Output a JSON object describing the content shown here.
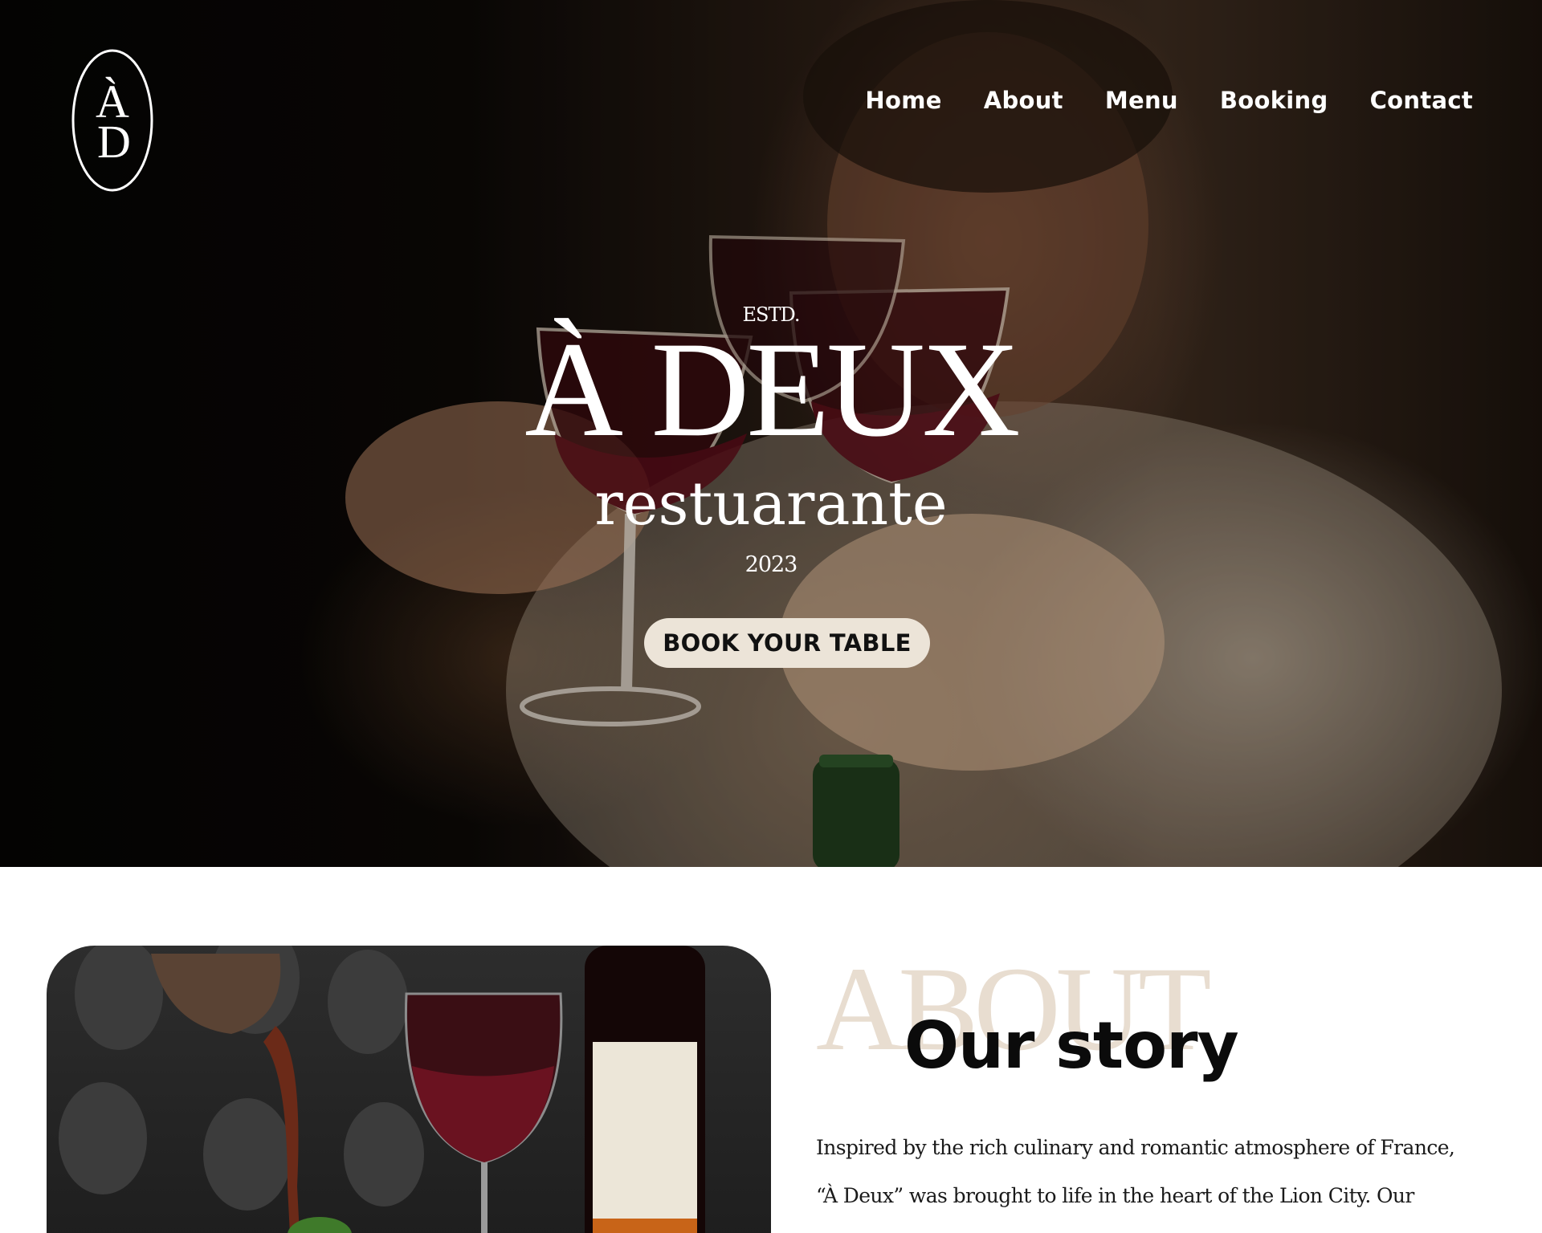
{
  "logo": {
    "letters_top": "À",
    "letters_bottom": "D"
  },
  "nav": {
    "items": [
      {
        "label": "Home"
      },
      {
        "label": "About"
      },
      {
        "label": "Menu"
      },
      {
        "label": "Booking"
      },
      {
        "label": "Contact"
      }
    ]
  },
  "hero": {
    "estd": "ESTD.",
    "title": "À DEUX",
    "subtitle": "restuarante",
    "year": "2023",
    "cta_label": "BOOK YOUR TABLE"
  },
  "about": {
    "watermark": "ABOUT",
    "heading": "Our story",
    "body_line_1": "Inspired by the rich culinary and romantic atmosphere of France,",
    "body_line_2": "“À Deux” was brought to life in the heart of the Lion City. Our"
  },
  "colors": {
    "cta_bg": "#ece4d8",
    "watermark": "#e8ddd0",
    "heading": "#0b0b0b"
  }
}
